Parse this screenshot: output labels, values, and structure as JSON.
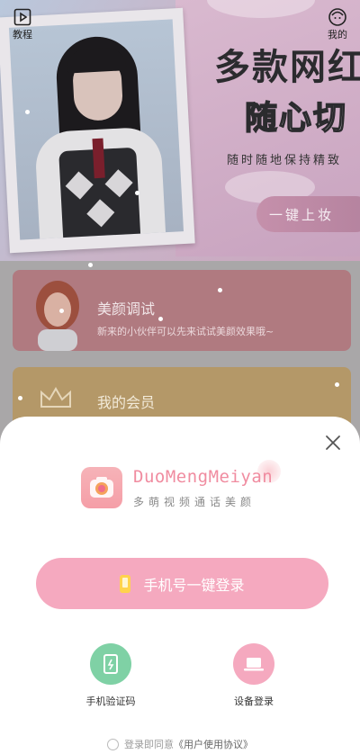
{
  "header": {
    "tutorial_label": "教程",
    "profile_label": "我的"
  },
  "hero": {
    "title_line1": "多款网红",
    "title_line2": "随心切",
    "subtitle": "随时随地保持精致",
    "cta_label": "一键上妆"
  },
  "cards": {
    "beauty": {
      "title": "美颜调试",
      "desc": "新来的小伙伴可以先来试试美颜效果哦~"
    },
    "vip": {
      "title": "我的会员"
    }
  },
  "login_sheet": {
    "brand_name": "DuoMengMeiyan",
    "brand_subtitle": "多萌视频通话美颜",
    "phone_login_label": "手机号一键登录",
    "sms_login_label": "手机验证码",
    "device_login_label": "设备登录",
    "agreement_prefix": "登录即同意",
    "agreement_link": "《用户使用协议》"
  },
  "colors": {
    "accent_pink": "#f5a9bf",
    "sms_green": "#7fd1a5",
    "device_pink": "#f5a9bf"
  }
}
